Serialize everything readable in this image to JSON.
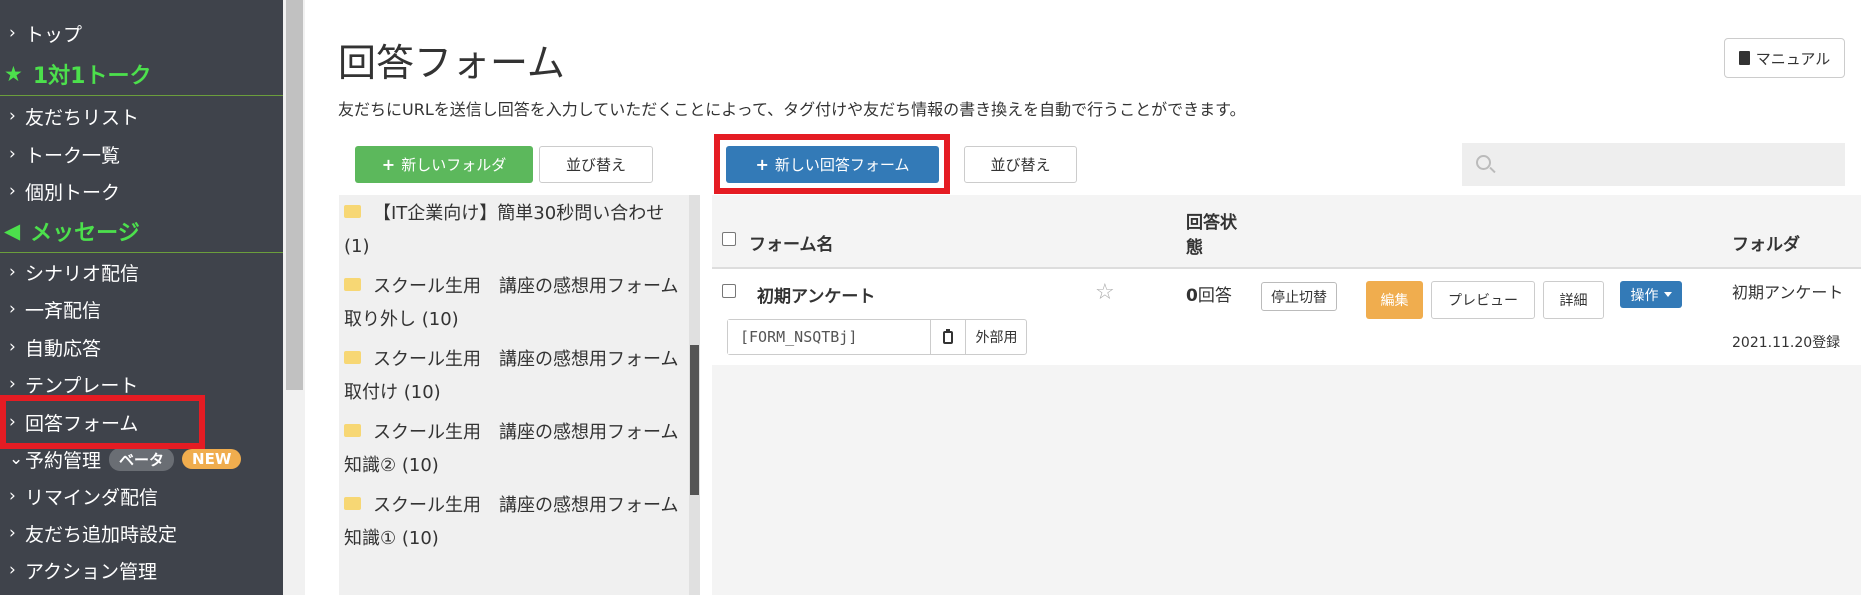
{
  "sidebar": {
    "items": [
      {
        "type": "item",
        "label": "トップ",
        "chevron": "›"
      },
      {
        "type": "section",
        "label": "1対1トーク",
        "icon": "★"
      },
      {
        "type": "item",
        "label": "友だちリスト",
        "chevron": "›"
      },
      {
        "type": "item",
        "label": "トーク一覧",
        "chevron": "›"
      },
      {
        "type": "item",
        "label": "個別トーク",
        "chevron": "›"
      },
      {
        "type": "section",
        "label": "メッセージ",
        "icon": "◀"
      },
      {
        "type": "item",
        "label": "シナリオ配信",
        "chevron": "›"
      },
      {
        "type": "item",
        "label": "一斉配信",
        "chevron": "›"
      },
      {
        "type": "item",
        "label": "自動応答",
        "chevron": "›"
      },
      {
        "type": "item",
        "label": "テンプレート",
        "chevron": "›"
      },
      {
        "type": "item",
        "label": "回答フォーム",
        "chevron": "›",
        "active": true
      },
      {
        "type": "item",
        "label": "予約管理",
        "chevron": "⌄",
        "badges": [
          "ベータ",
          "NEW"
        ]
      },
      {
        "type": "item",
        "label": "リマインダ配信",
        "chevron": "›"
      },
      {
        "type": "item",
        "label": "友だち追加時設定",
        "chevron": "›"
      },
      {
        "type": "item",
        "label": "アクション管理",
        "chevron": "›"
      }
    ]
  },
  "header": {
    "title": "回答フォーム",
    "description": "友だちにURLを送信し回答を入力していただくことによって、タグ付けや友だち情報の書き換えを自動で行うことができます。",
    "manual_label": "マニュアル"
  },
  "toolbar": {
    "new_folder_label": "新しいフォルダ",
    "folder_sort_label": "並び替え",
    "new_form_label": "新しい回答フォーム",
    "form_sort_label": "並び替え",
    "search_placeholder": ""
  },
  "folders": [
    {
      "line1": "【IT企業向け】簡単30秒問い合わせ",
      "line2": "(1)"
    },
    {
      "line1": "スクール生用　講座の感想用フォーム",
      "line2": "取り外し (10)"
    },
    {
      "line1": "スクール生用　講座の感想用フォーム",
      "line2": "取付け (10)"
    },
    {
      "line1": "スクール生用　講座の感想用フォーム",
      "line2": "知識② (10)"
    },
    {
      "line1": "スクール生用　講座の感想用フォーム",
      "line2": "知識① (10)"
    }
  ],
  "table": {
    "headers": {
      "name": "フォーム名",
      "status_line1": "回答状",
      "status_line2": "態",
      "folder": "フォルダ"
    },
    "rows": [
      {
        "name": "初期アンケート",
        "form_id": "[FORM_NSQTBj]",
        "external_label": "外部用",
        "answer_count": "0",
        "answer_unit": "回答",
        "stop_toggle_label": "停止切替",
        "edit_label": "編集",
        "preview_label": "プレビュー",
        "detail_label": "詳細",
        "ops_label": "操作",
        "folder": "初期アンケート",
        "registered": "2021.11.20登録"
      }
    ]
  },
  "colors": {
    "sidebar_bg": "#3f434b",
    "section_green": "#4ce04c",
    "highlight_red": "#e51c23",
    "primary_blue": "#337ab7",
    "success_green": "#5cb85c",
    "warning_orange": "#f0ad4e"
  }
}
